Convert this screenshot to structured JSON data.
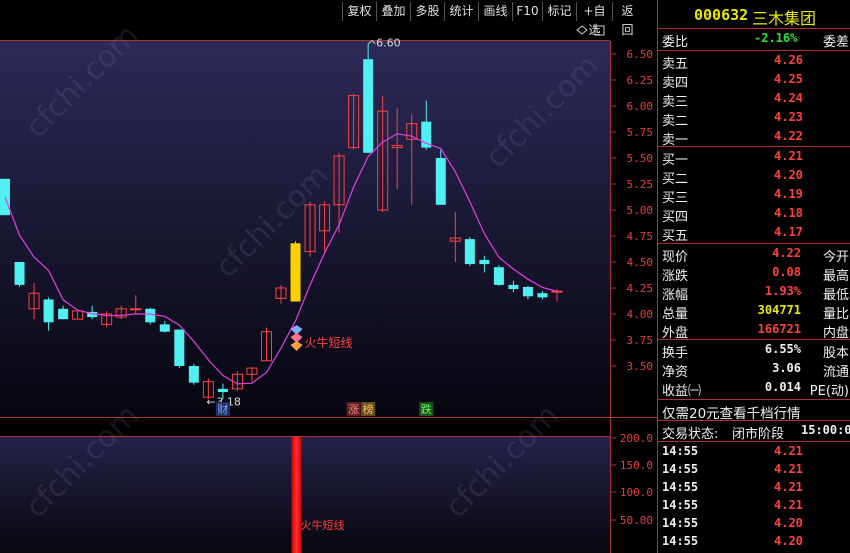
{
  "toolbar": {
    "buttons": [
      "复权",
      "叠加",
      "多股",
      "统计",
      "画线",
      "F10",
      "标记",
      "+自选",
      "返回"
    ]
  },
  "stock": {
    "code": "000632",
    "name": "三木集团"
  },
  "order_ratio": {
    "label": "委比",
    "value": "-2.16%",
    "label2": "委差"
  },
  "asks": [
    {
      "label": "卖五",
      "price": "4.26"
    },
    {
      "label": "卖四",
      "price": "4.25"
    },
    {
      "label": "卖三",
      "price": "4.24"
    },
    {
      "label": "卖二",
      "price": "4.23"
    },
    {
      "label": "卖一",
      "price": "4.22"
    }
  ],
  "bids": [
    {
      "label": "买一",
      "price": "4.21"
    },
    {
      "label": "买二",
      "price": "4.20"
    },
    {
      "label": "买三",
      "price": "4.19"
    },
    {
      "label": "买四",
      "price": "4.18"
    },
    {
      "label": "买五",
      "price": "4.17"
    }
  ],
  "quote": [
    {
      "label": "现价",
      "value": "4.22",
      "label2": "今开",
      "color": "#ff4040"
    },
    {
      "label": "涨跌",
      "value": "0.08",
      "label2": "最高",
      "color": "#ff4040"
    },
    {
      "label": "涨幅",
      "value": "1.93%",
      "label2": "最低",
      "color": "#ff4040"
    },
    {
      "label": "总量",
      "value": "304771",
      "label2": "量比",
      "color": "#e8e800"
    },
    {
      "label": "外盘",
      "value": "166721",
      "label2": "内盘",
      "color": "#ff4040"
    }
  ],
  "stats": [
    {
      "label": "换手",
      "value": "6.55%",
      "label2": "股本"
    },
    {
      "label": "净资",
      "value": "3.06",
      "label2": "流通"
    },
    {
      "label": "收益㈠",
      "value": "0.014",
      "label2": "PE(动)"
    }
  ],
  "promo": "仅需20元查看千档行情",
  "trade_status": {
    "label": "交易状态:",
    "value": "闭市阶段",
    "time": "15:00:0"
  },
  "ticks": [
    {
      "time": "14:55",
      "price": "4.21"
    },
    {
      "time": "14:55",
      "price": "4.21"
    },
    {
      "time": "14:55",
      "price": "4.21"
    },
    {
      "time": "14:55",
      "price": "4.21"
    },
    {
      "time": "14:55",
      "price": "4.20"
    },
    {
      "time": "14:55",
      "price": "4.20"
    }
  ],
  "chart_data": {
    "type": "candlestick",
    "price_axis": {
      "ticks": [
        "6.50",
        "6.25",
        "6.00",
        "5.75",
        "5.50",
        "5.25",
        "5.00",
        "4.75",
        "4.50",
        "4.25",
        "4.00",
        "3.75",
        "3.50"
      ],
      "min": 3.3,
      "max": 6.7
    },
    "volume_axis": {
      "ticks": [
        "200.0",
        "150.0",
        "100.0",
        "50.00"
      ]
    },
    "annotations": {
      "high": "6.60",
      "low": "3.18",
      "signal": "火牛短线",
      "volume_signal": "火牛短线"
    },
    "markers": [
      "财",
      "涨",
      "榜",
      "跌"
    ],
    "candles": [
      {
        "o": 5.3,
        "c": 4.95,
        "h": 5.3,
        "l": 4.95
      },
      {
        "o": 4.5,
        "c": 4.28,
        "h": 4.5,
        "l": 4.26
      },
      {
        "o": 4.05,
        "c": 4.2,
        "h": 4.3,
        "l": 3.95
      },
      {
        "o": 4.14,
        "c": 3.92,
        "h": 4.16,
        "l": 3.84
      },
      {
        "o": 4.05,
        "c": 3.95,
        "h": 4.08,
        "l": 3.95
      },
      {
        "o": 3.95,
        "c": 4.03,
        "h": 4.04,
        "l": 3.95
      },
      {
        "o": 4.02,
        "c": 3.97,
        "h": 4.08,
        "l": 3.95
      },
      {
        "o": 3.9,
        "c": 4.0,
        "h": 4.03,
        "l": 3.87
      },
      {
        "o": 3.97,
        "c": 4.05,
        "h": 4.08,
        "l": 3.95
      },
      {
        "o": 4.05,
        "c": 4.05,
        "h": 4.18,
        "l": 4.0
      },
      {
        "o": 4.05,
        "c": 3.92,
        "h": 4.06,
        "l": 3.9
      },
      {
        "o": 3.9,
        "c": 3.83,
        "h": 3.93,
        "l": 3.82
      },
      {
        "o": 3.85,
        "c": 3.5,
        "h": 3.85,
        "l": 3.48
      },
      {
        "o": 3.5,
        "c": 3.34,
        "h": 3.52,
        "l": 3.32
      },
      {
        "o": 3.2,
        "c": 3.35,
        "h": 3.38,
        "l": 3.18
      },
      {
        "o": 3.28,
        "c": 3.25,
        "h": 3.33,
        "l": 3.18
      },
      {
        "o": 3.28,
        "c": 3.42,
        "h": 3.45,
        "l": 3.26
      },
      {
        "o": 3.42,
        "c": 3.48,
        "h": 3.49,
        "l": 3.35
      },
      {
        "o": 3.55,
        "c": 3.83,
        "h": 3.87,
        "l": 3.55
      },
      {
        "o": 4.15,
        "c": 4.25,
        "h": 4.28,
        "l": 4.1
      },
      {
        "o": 4.12,
        "c": 4.68,
        "h": 4.7,
        "l": 4.12,
        "signal": true
      },
      {
        "o": 4.6,
        "c": 5.05,
        "h": 5.08,
        "l": 4.55
      },
      {
        "o": 4.8,
        "c": 5.05,
        "h": 5.08,
        "l": 4.6
      },
      {
        "o": 5.05,
        "c": 5.52,
        "h": 5.55,
        "l": 4.78
      },
      {
        "o": 5.6,
        "c": 6.1,
        "h": 6.12,
        "l": 5.58
      },
      {
        "o": 6.45,
        "c": 5.55,
        "h": 6.6,
        "l": 5.55
      },
      {
        "o": 5.0,
        "c": 5.95,
        "h": 6.1,
        "l": 4.98
      },
      {
        "o": 5.6,
        "c": 5.62,
        "h": 5.98,
        "l": 5.2
      },
      {
        "o": 5.68,
        "c": 5.83,
        "h": 5.92,
        "l": 5.05
      },
      {
        "o": 5.85,
        "c": 5.6,
        "h": 6.05,
        "l": 5.58
      },
      {
        "o": 5.5,
        "c": 5.05,
        "h": 5.58,
        "l": 5.05
      },
      {
        "o": 4.7,
        "c": 4.73,
        "h": 4.98,
        "l": 4.5
      },
      {
        "o": 4.72,
        "c": 4.48,
        "h": 4.74,
        "l": 4.46
      },
      {
        "o": 4.52,
        "c": 4.48,
        "h": 4.56,
        "l": 4.4
      },
      {
        "o": 4.45,
        "c": 4.28,
        "h": 4.47,
        "l": 4.27
      },
      {
        "o": 4.28,
        "c": 4.24,
        "h": 4.32,
        "l": 4.21
      },
      {
        "o": 4.26,
        "c": 4.17,
        "h": 4.27,
        "l": 4.14
      },
      {
        "o": 4.2,
        "c": 4.16,
        "h": 4.22,
        "l": 4.14
      },
      {
        "o": 4.22,
        "c": 4.22,
        "h": 4.24,
        "l": 4.12
      }
    ]
  }
}
